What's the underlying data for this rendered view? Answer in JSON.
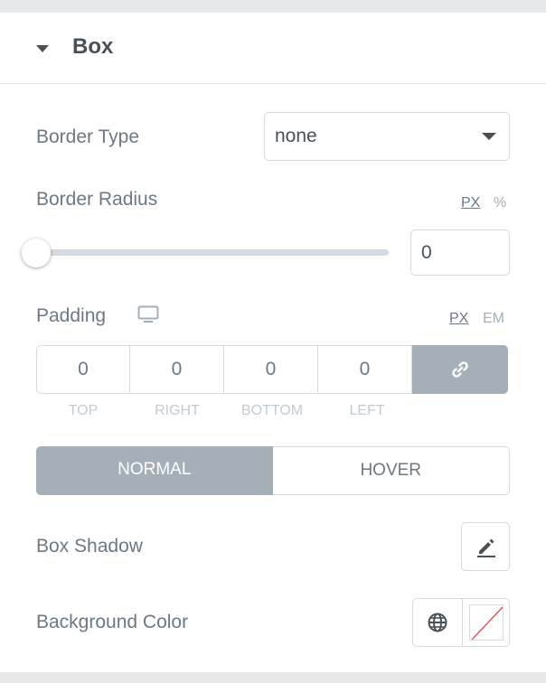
{
  "section": {
    "title": "Box"
  },
  "border_type": {
    "label": "Border Type",
    "value": "none"
  },
  "border_radius": {
    "label": "Border Radius",
    "units": [
      "PX",
      "%"
    ],
    "active_unit": "PX",
    "value": "0",
    "slider_level": 0
  },
  "padding": {
    "label": "Padding",
    "units": [
      "PX",
      "EM"
    ],
    "active_unit": "PX",
    "fields": [
      {
        "value": "0",
        "label": "TOP"
      },
      {
        "value": "0",
        "label": "RIGHT"
      },
      {
        "value": "0",
        "label": "BOTTOM"
      },
      {
        "value": "0",
        "label": "LEFT"
      }
    ],
    "linked": true
  },
  "state_tabs": {
    "normal": "NORMAL",
    "hover": "HOVER",
    "active": "NORMAL"
  },
  "box_shadow": {
    "label": "Box Shadow"
  },
  "background_color": {
    "label": "Background Color",
    "value": "none"
  },
  "colors": {
    "accent_gray": "#a4afb7",
    "text": "#6d7882",
    "heading": "#495157",
    "no_color_slash": "#e25a5a"
  },
  "icons": {
    "caret": "caret-down-icon",
    "select_arrow": "chevron-down-icon",
    "device": "desktop-monitor-icon",
    "link": "link-icon",
    "edit": "pencil-edit-icon",
    "global": "globe-icon"
  }
}
